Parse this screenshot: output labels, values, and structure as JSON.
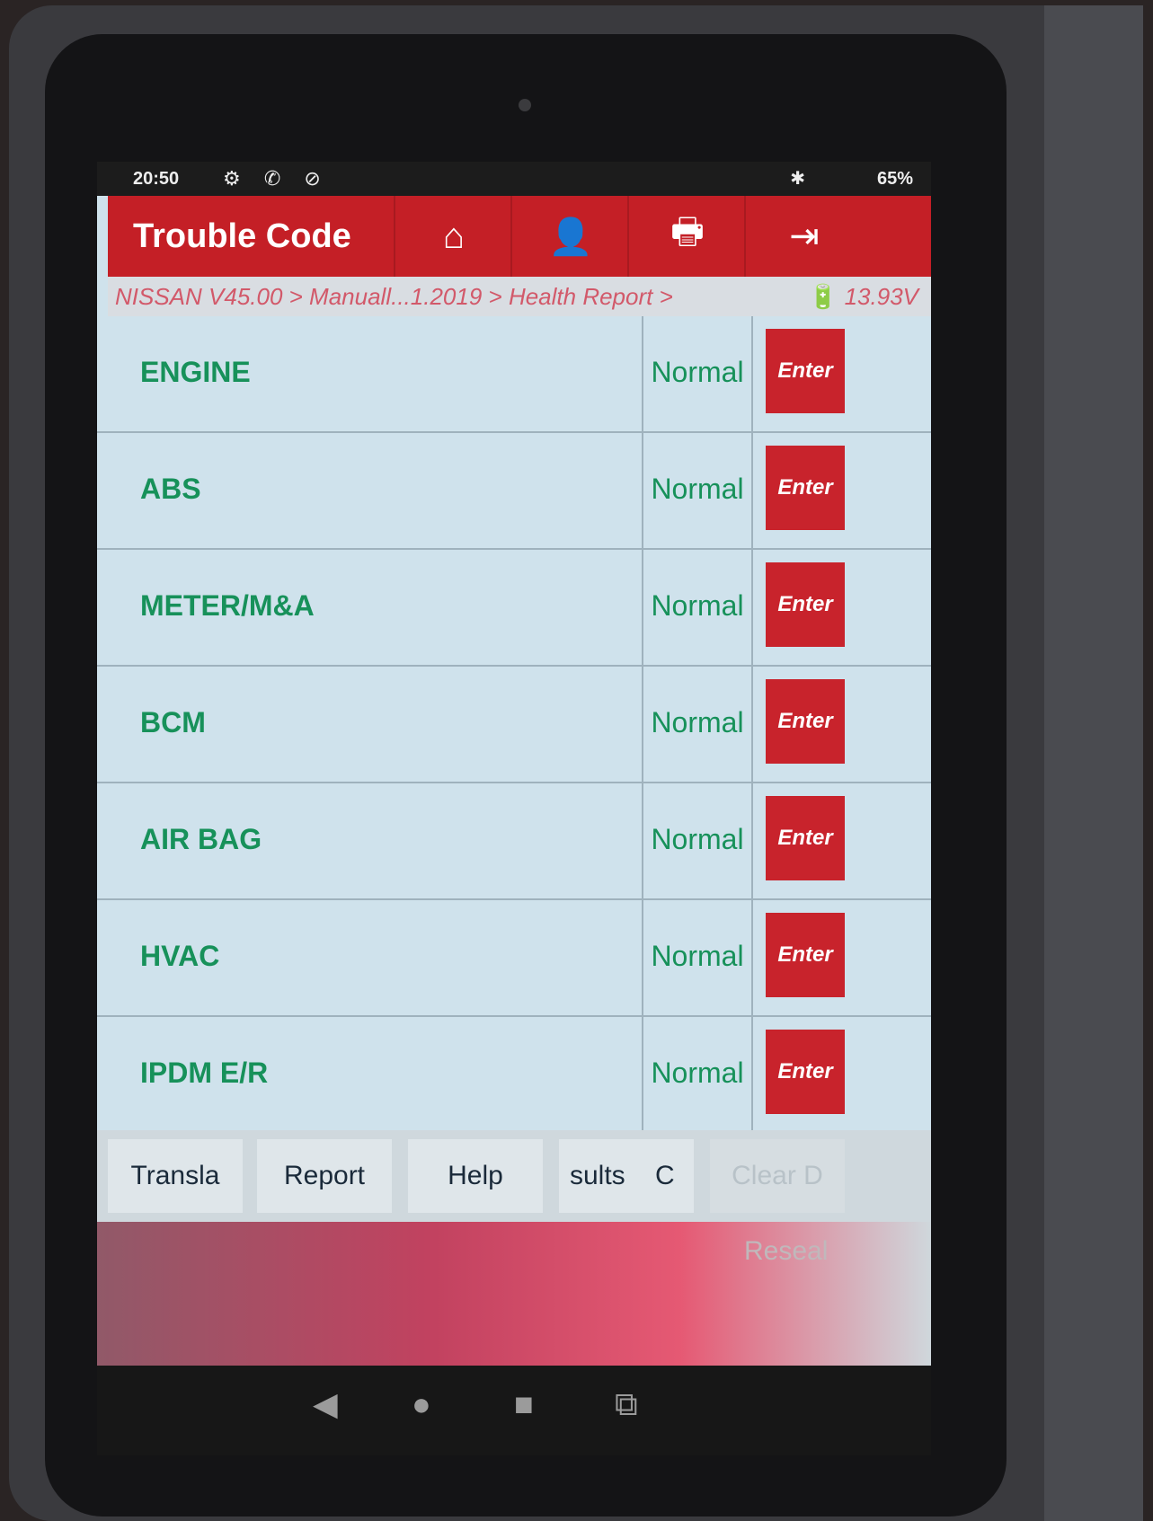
{
  "status_bar": {
    "time": "20:50",
    "battery": "65%"
  },
  "title_bar": {
    "title": "Trouble Code",
    "buttons": [
      {
        "icon": "home-icon",
        "glyph": "⌂"
      },
      {
        "icon": "user-icon",
        "glyph": "👤"
      },
      {
        "icon": "print-icon",
        "glyph": "🖶"
      },
      {
        "icon": "exit-icon",
        "glyph": "⇥"
      }
    ]
  },
  "breadcrumb": {
    "path": "NISSAN V45.00 > Manuall...1.2019 > Health Report >",
    "voltage": "13.93V"
  },
  "systems": [
    {
      "name": "ENGINE",
      "status": "Normal",
      "action": "Enter"
    },
    {
      "name": "ABS",
      "status": "Normal",
      "action": "Enter"
    },
    {
      "name": "METER/M&A",
      "status": "Normal",
      "action": "Enter"
    },
    {
      "name": "BCM",
      "status": "Normal",
      "action": "Enter"
    },
    {
      "name": "AIR BAG",
      "status": "Normal",
      "action": "Enter"
    },
    {
      "name": "HVAC",
      "status": "Normal",
      "action": "Enter"
    },
    {
      "name": "IPDM E/R",
      "status": "Normal",
      "action": "Enter"
    }
  ],
  "bottom_bar": {
    "translate": "Transla",
    "report": "Report",
    "help": "Help",
    "results": "sults",
    "clear_partial": "C",
    "clear_dtc": "Clear D"
  },
  "extra_action": "Reseal",
  "colors": {
    "brand_red": "#c41f26",
    "status_green": "#17915a"
  }
}
